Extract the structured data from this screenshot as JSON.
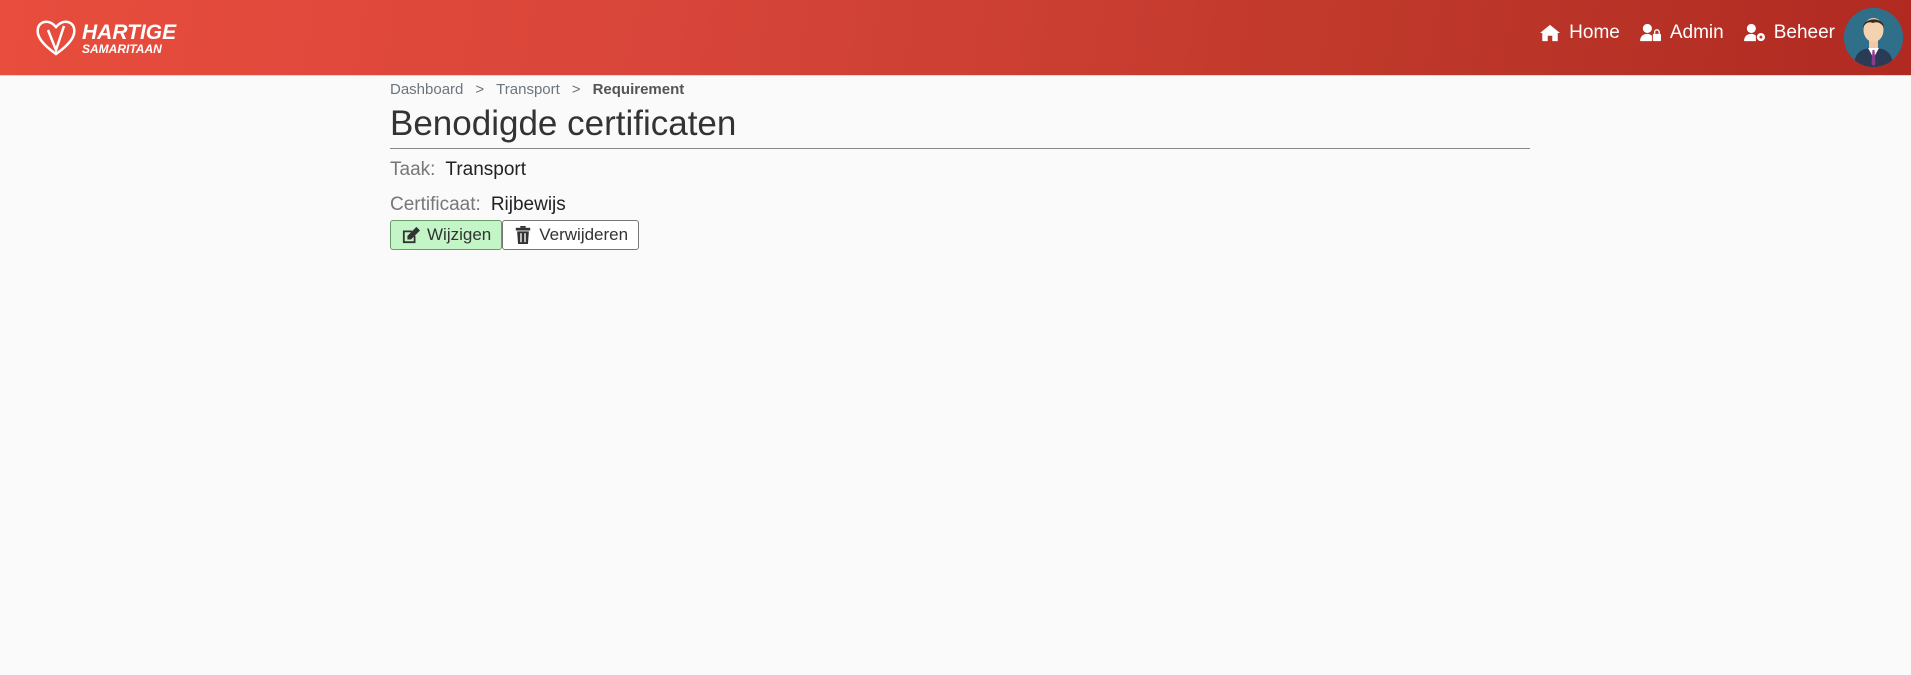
{
  "header": {
    "logo_line1": "HARTIGE",
    "logo_line2": "SAMARITAAN",
    "nav": [
      {
        "label": "Home",
        "icon": "home-icon"
      },
      {
        "label": "Admin",
        "icon": "user-lock-icon"
      },
      {
        "label": "Beheer",
        "icon": "user-cog-icon"
      }
    ]
  },
  "breadcrumb": {
    "items": [
      "Dashboard",
      "Transport",
      "Requirement"
    ],
    "separator": ">"
  },
  "page": {
    "title": "Benodigde certificaten",
    "fields": [
      {
        "label": "Taak:",
        "value": "Transport"
      },
      {
        "label": "Certificaat:",
        "value": "Rijbewijs"
      }
    ]
  },
  "actions": {
    "edit_label": "Wijzigen",
    "delete_label": "Verwijderen"
  },
  "colors": {
    "header_start": "#e84d3d",
    "header_end": "#b02a22",
    "edit_button_bg": "#c3f5c7"
  }
}
